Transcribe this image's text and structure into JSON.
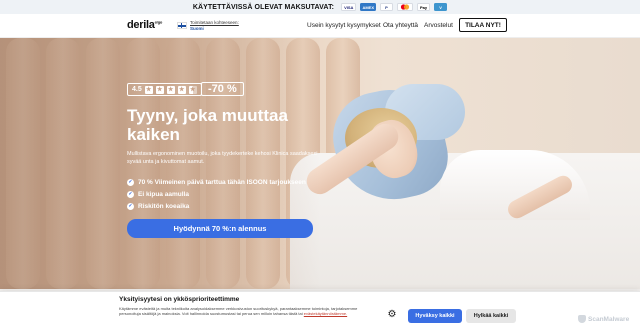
{
  "promo_bar": {
    "text": "KÄYTETTÄVISSÄ OLEVAT MAKSUTAVAT:",
    "payment_methods": [
      {
        "name": "visa-icon",
        "label": "VISA"
      },
      {
        "name": "amex-icon",
        "label": "AMEX"
      },
      {
        "name": "paypal-icon",
        "label": "P"
      },
      {
        "name": "mastercard-icon",
        "label": ""
      },
      {
        "name": "apple-pay-icon",
        "label": "Pay"
      },
      {
        "name": "venmo-icon",
        "label": "V"
      }
    ]
  },
  "header": {
    "logo": "derila",
    "logo_suffix": "ergo",
    "shipping_line1": "Toimitetaan kohteeseen:",
    "shipping_line2": "Suomi",
    "nav": [
      "Usein kysytyt kysymykset",
      "Ota yhteyttä",
      "Arvostelut"
    ],
    "order_button": "TILAA NYT!"
  },
  "hero": {
    "rating": "4.5",
    "stars": 4.5,
    "discount": "-70 %",
    "headline": "Tyyny, joka muuttaa kaiken",
    "subtext": "Mullistava ergonominen muotoilu, joka tyydekerteke kehosi Klinica saadaksesi syvää unta ja kivuttomat aamut.",
    "bullets": [
      "70 % Viimeinen päivä tarttua tähän ISOON tarjoukseen",
      "Ei kipua aamulla",
      "Riskitön koeaika"
    ],
    "cta": "Hyödynnä 70 %:n alennus"
  },
  "cookie_banner": {
    "title": "Yksityisyytesi on ykkösprioriteettimme",
    "text": "Käytämme evästeitä ja muita tekniikoita analysoidaksemme verkkosivuston suorituskykyä, parantaaksemme toimintoja, tarjotaksemme personoituja sisältöjä ja mainoksia. Voit hallinnoida suostumustasi tai perua sen milloin tahansa tästä tai",
    "link": "evästekäytännöstämme.",
    "accept": "Hyväksy kaikki",
    "reject": "Hylkää kaikki"
  },
  "watermark": "ScanMalware",
  "colors": {
    "accent": "#3a6ee3",
    "promo_bg": "#eef2f6"
  }
}
